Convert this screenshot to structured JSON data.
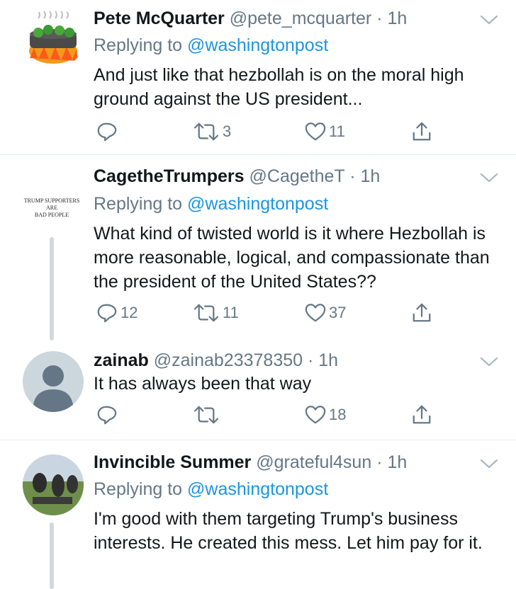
{
  "colors": {
    "link": "#1b95e0",
    "secondary": "#657786",
    "text": "#14171a",
    "divider": "#e6ecf0"
  },
  "tweets": [
    {
      "name": "Pete McQuarter",
      "handle": "@pete_mcquarter",
      "time": "· 1h",
      "replying_prefix": "Replying to",
      "replying_to": "@washingtonpost",
      "text": "And just like that hezbollah is on the moral high ground against the US president...",
      "reply_count": "",
      "retweet_count": "3",
      "like_count": "11",
      "avatar_icon": "frog-pot-icon"
    },
    {
      "name": "CagetheTrumpers",
      "handle": "@CagetheT",
      "time": "· 1h",
      "replying_prefix": "Replying to",
      "replying_to": "@washingtonpost",
      "text": "What kind of twisted world is it where Hezbollah is more reasonable, logical, and compassionate than the president of the United States??",
      "reply_count": "12",
      "retweet_count": "11",
      "like_count": "37",
      "avatar_lines": [
        "TRUMP SUPPORTERS",
        "ARE",
        "BAD PEOPLE"
      ]
    },
    {
      "name": "zainab",
      "handle": "@zainab23378350",
      "time": "· 1h",
      "text": "It has always been that way",
      "reply_count": "",
      "retweet_count": "",
      "like_count": "18",
      "avatar_icon": "default-user-icon"
    },
    {
      "name": "Invincible Summer",
      "handle": "@grateful4sun",
      "time": "· 1h",
      "replying_prefix": "Replying to",
      "replying_to": "@washingtonpost",
      "text": "I'm good with them targeting Trump's business interests. He created this mess. Let him pay for it.",
      "avatar_icon": "sculpture-photo-icon"
    }
  ]
}
